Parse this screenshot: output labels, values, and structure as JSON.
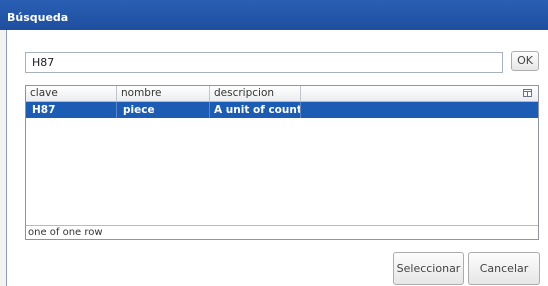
{
  "window": {
    "title": "Búsqueda"
  },
  "search": {
    "value": "H87",
    "ok_label": "OK"
  },
  "grid": {
    "columns": [
      "clave",
      "nombre",
      "descripcion"
    ],
    "rows": [
      {
        "clave": "H87",
        "nombre": "piece",
        "descripcion": "A unit of count…",
        "selected": true
      }
    ],
    "status": "one of one row",
    "column_chooser_icon": "column-chooser-icon"
  },
  "footer": {
    "select_label": "Seleccionar",
    "cancel_label": "Cancelar"
  },
  "colors": {
    "titlebar": "#1e4e9e",
    "selection": "#1c5cb5"
  }
}
